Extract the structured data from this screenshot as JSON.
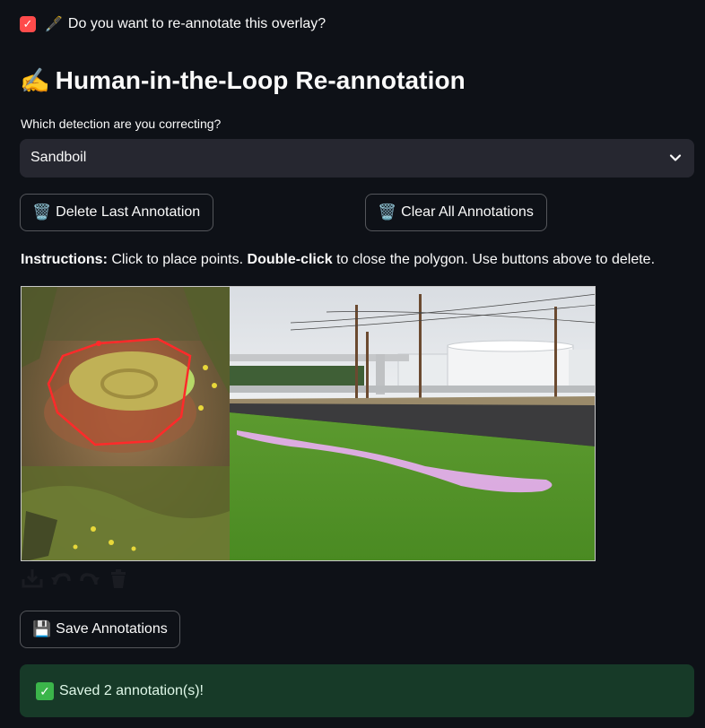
{
  "checkbox": {
    "checked": true,
    "glyph": "🖋️",
    "label": "Do you want to re-annotate this overlay?"
  },
  "heading": {
    "emoji": "✍️",
    "text": "Human-in-the-Loop Re-annotation"
  },
  "detection_select": {
    "label": "Which detection are you correcting?",
    "value": "Sandboil"
  },
  "buttons": {
    "delete_last": {
      "glyph": "🗑️",
      "label": "Delete Last Annotation"
    },
    "clear_all": {
      "glyph": "🗑️",
      "label": "Clear All Annotations"
    },
    "save": {
      "glyph": "💾",
      "label": "Save Annotations"
    }
  },
  "instructions": {
    "prefix": "Instructions:",
    "part1": " Click to place points. ",
    "bold2": "Double-click",
    "part2": " to close the polygon. Use buttons above to delete."
  },
  "canvas_toolbar": [
    "download-icon",
    "undo-icon",
    "redo-icon",
    "trash-icon"
  ],
  "success": {
    "text": "Saved 2 annotation(s)!"
  },
  "colors": {
    "accent": "#ff4b4b",
    "background": "#0e1117",
    "input_bg": "#262730",
    "success_bg": "#173a28"
  }
}
